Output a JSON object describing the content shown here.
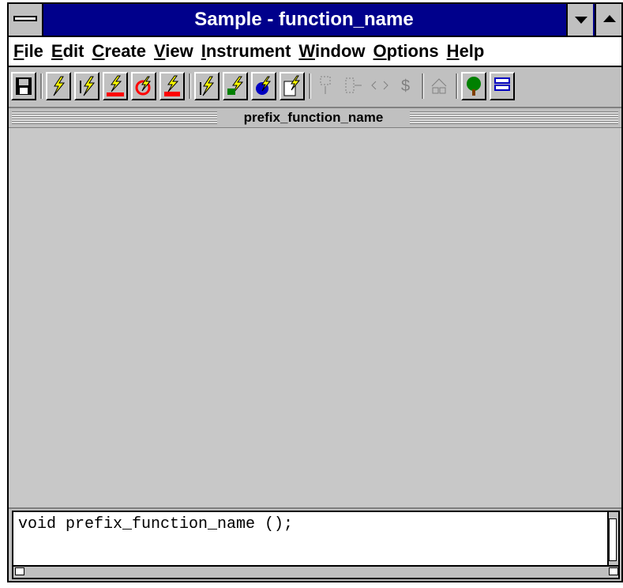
{
  "window": {
    "title": "Sample - function_name"
  },
  "menu": {
    "items": [
      "File",
      "Edit",
      "Create",
      "View",
      "Instrument",
      "Window",
      "Options",
      "Help"
    ]
  },
  "toolbar": {
    "buttons": [
      {
        "icon": "save-icon"
      },
      {
        "icon": "lightning-icon"
      },
      {
        "icon": "lightning-arrows-icon"
      },
      {
        "icon": "lightning-binary-icon"
      },
      {
        "icon": "lightning-circle-icon"
      },
      {
        "icon": "lightning-numbers-icon"
      },
      {
        "icon": "lightning-up-icon"
      },
      {
        "icon": "lightning-swap-icon"
      },
      {
        "icon": "lightning-globe-icon"
      },
      {
        "icon": "lightning-document-icon"
      },
      {
        "icon": "disabled-node-icon"
      },
      {
        "icon": "disabled-link-icon"
      },
      {
        "icon": "disabled-compare-icon"
      },
      {
        "icon": "disabled-dollar-icon"
      },
      {
        "icon": "disabled-split-icon"
      },
      {
        "icon": "tree-icon"
      },
      {
        "icon": "stack-icon"
      }
    ]
  },
  "canvas": {
    "header": "prefix_function_name"
  },
  "code": {
    "text": "void prefix_function_name ();"
  },
  "colors": {
    "titlebar": "#00008b",
    "chrome": "#c0c0c0",
    "canvas": "#c8c8c8",
    "lightning": "#ffff00"
  }
}
